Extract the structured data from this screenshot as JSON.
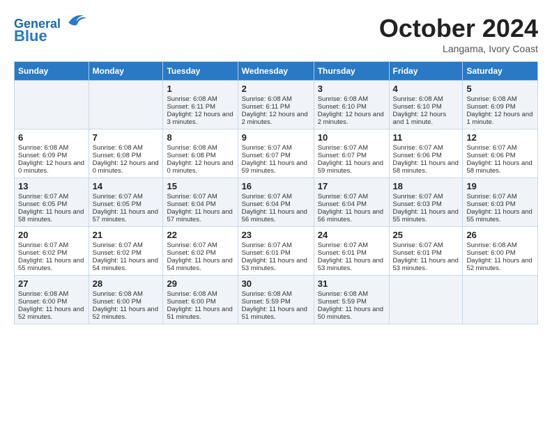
{
  "header": {
    "logo_line1": "General",
    "logo_line2": "Blue",
    "month": "October 2024",
    "location": "Langama, Ivory Coast"
  },
  "days_of_week": [
    "Sunday",
    "Monday",
    "Tuesday",
    "Wednesday",
    "Thursday",
    "Friday",
    "Saturday"
  ],
  "weeks": [
    [
      {
        "day": "",
        "empty": true
      },
      {
        "day": "",
        "empty": true
      },
      {
        "day": "1",
        "sunrise": "Sunrise: 6:08 AM",
        "sunset": "Sunset: 6:11 PM",
        "daylight": "Daylight: 12 hours and 3 minutes."
      },
      {
        "day": "2",
        "sunrise": "Sunrise: 6:08 AM",
        "sunset": "Sunset: 6:11 PM",
        "daylight": "Daylight: 12 hours and 2 minutes."
      },
      {
        "day": "3",
        "sunrise": "Sunrise: 6:08 AM",
        "sunset": "Sunset: 6:10 PM",
        "daylight": "Daylight: 12 hours and 2 minutes."
      },
      {
        "day": "4",
        "sunrise": "Sunrise: 6:08 AM",
        "sunset": "Sunset: 6:10 PM",
        "daylight": "Daylight: 12 hours and 1 minute."
      },
      {
        "day": "5",
        "sunrise": "Sunrise: 6:08 AM",
        "sunset": "Sunset: 6:09 PM",
        "daylight": "Daylight: 12 hours and 1 minute."
      }
    ],
    [
      {
        "day": "6",
        "sunrise": "Sunrise: 6:08 AM",
        "sunset": "Sunset: 6:09 PM",
        "daylight": "Daylight: 12 hours and 0 minutes."
      },
      {
        "day": "7",
        "sunrise": "Sunrise: 6:08 AM",
        "sunset": "Sunset: 6:08 PM",
        "daylight": "Daylight: 12 hours and 0 minutes."
      },
      {
        "day": "8",
        "sunrise": "Sunrise: 6:08 AM",
        "sunset": "Sunset: 6:08 PM",
        "daylight": "Daylight: 12 hours and 0 minutes."
      },
      {
        "day": "9",
        "sunrise": "Sunrise: 6:07 AM",
        "sunset": "Sunset: 6:07 PM",
        "daylight": "Daylight: 11 hours and 59 minutes."
      },
      {
        "day": "10",
        "sunrise": "Sunrise: 6:07 AM",
        "sunset": "Sunset: 6:07 PM",
        "daylight": "Daylight: 11 hours and 59 minutes."
      },
      {
        "day": "11",
        "sunrise": "Sunrise: 6:07 AM",
        "sunset": "Sunset: 6:06 PM",
        "daylight": "Daylight: 11 hours and 58 minutes."
      },
      {
        "day": "12",
        "sunrise": "Sunrise: 6:07 AM",
        "sunset": "Sunset: 6:06 PM",
        "daylight": "Daylight: 11 hours and 58 minutes."
      }
    ],
    [
      {
        "day": "13",
        "sunrise": "Sunrise: 6:07 AM",
        "sunset": "Sunset: 6:05 PM",
        "daylight": "Daylight: 11 hours and 58 minutes."
      },
      {
        "day": "14",
        "sunrise": "Sunrise: 6:07 AM",
        "sunset": "Sunset: 6:05 PM",
        "daylight": "Daylight: 11 hours and 57 minutes."
      },
      {
        "day": "15",
        "sunrise": "Sunrise: 6:07 AM",
        "sunset": "Sunset: 6:04 PM",
        "daylight": "Daylight: 11 hours and 57 minutes."
      },
      {
        "day": "16",
        "sunrise": "Sunrise: 6:07 AM",
        "sunset": "Sunset: 6:04 PM",
        "daylight": "Daylight: 11 hours and 56 minutes."
      },
      {
        "day": "17",
        "sunrise": "Sunrise: 6:07 AM",
        "sunset": "Sunset: 6:04 PM",
        "daylight": "Daylight: 11 hours and 56 minutes."
      },
      {
        "day": "18",
        "sunrise": "Sunrise: 6:07 AM",
        "sunset": "Sunset: 6:03 PM",
        "daylight": "Daylight: 11 hours and 55 minutes."
      },
      {
        "day": "19",
        "sunrise": "Sunrise: 6:07 AM",
        "sunset": "Sunset: 6:03 PM",
        "daylight": "Daylight: 11 hours and 55 minutes."
      }
    ],
    [
      {
        "day": "20",
        "sunrise": "Sunrise: 6:07 AM",
        "sunset": "Sunset: 6:02 PM",
        "daylight": "Daylight: 11 hours and 55 minutes."
      },
      {
        "day": "21",
        "sunrise": "Sunrise: 6:07 AM",
        "sunset": "Sunset: 6:02 PM",
        "daylight": "Daylight: 11 hours and 54 minutes."
      },
      {
        "day": "22",
        "sunrise": "Sunrise: 6:07 AM",
        "sunset": "Sunset: 6:02 PM",
        "daylight": "Daylight: 11 hours and 54 minutes."
      },
      {
        "day": "23",
        "sunrise": "Sunrise: 6:07 AM",
        "sunset": "Sunset: 6:01 PM",
        "daylight": "Daylight: 11 hours and 53 minutes."
      },
      {
        "day": "24",
        "sunrise": "Sunrise: 6:07 AM",
        "sunset": "Sunset: 6:01 PM",
        "daylight": "Daylight: 11 hours and 53 minutes."
      },
      {
        "day": "25",
        "sunrise": "Sunrise: 6:07 AM",
        "sunset": "Sunset: 6:01 PM",
        "daylight": "Daylight: 11 hours and 53 minutes."
      },
      {
        "day": "26",
        "sunrise": "Sunrise: 6:08 AM",
        "sunset": "Sunset: 6:00 PM",
        "daylight": "Daylight: 11 hours and 52 minutes."
      }
    ],
    [
      {
        "day": "27",
        "sunrise": "Sunrise: 6:08 AM",
        "sunset": "Sunset: 6:00 PM",
        "daylight": "Daylight: 11 hours and 52 minutes."
      },
      {
        "day": "28",
        "sunrise": "Sunrise: 6:08 AM",
        "sunset": "Sunset: 6:00 PM",
        "daylight": "Daylight: 11 hours and 52 minutes."
      },
      {
        "day": "29",
        "sunrise": "Sunrise: 6:08 AM",
        "sunset": "Sunset: 6:00 PM",
        "daylight": "Daylight: 11 hours and 51 minutes."
      },
      {
        "day": "30",
        "sunrise": "Sunrise: 6:08 AM",
        "sunset": "Sunset: 5:59 PM",
        "daylight": "Daylight: 11 hours and 51 minutes."
      },
      {
        "day": "31",
        "sunrise": "Sunrise: 6:08 AM",
        "sunset": "Sunset: 5:59 PM",
        "daylight": "Daylight: 11 hours and 50 minutes."
      },
      {
        "day": "",
        "empty": true
      },
      {
        "day": "",
        "empty": true
      }
    ]
  ]
}
